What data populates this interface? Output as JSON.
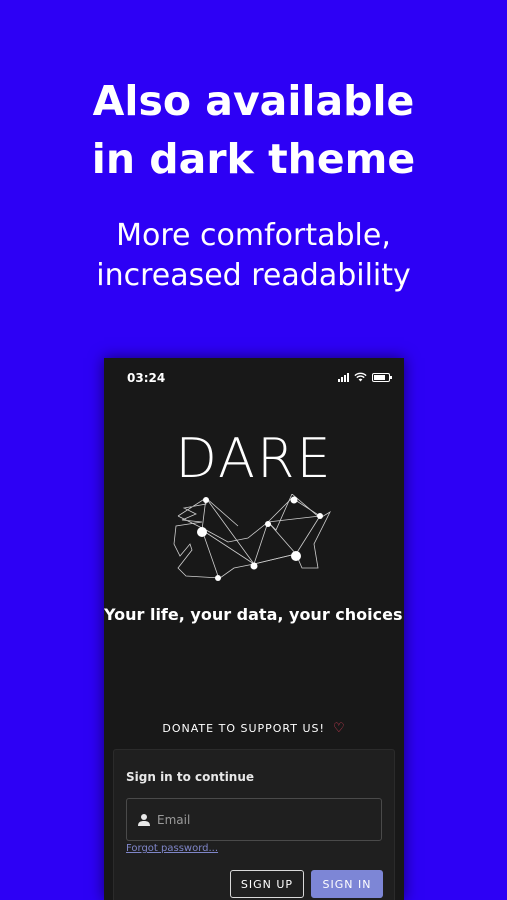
{
  "promo": {
    "headline_line1": "Also available",
    "headline_line2": "in dark theme",
    "subline_line1": "More comfortable,",
    "subline_line2": "increased readability"
  },
  "status_bar": {
    "time": "03:24",
    "icons": [
      "signal-icon",
      "wifi-icon",
      "battery-icon"
    ]
  },
  "app": {
    "logo_text": "DARE",
    "tagline": "Your life, your data, your choices.",
    "donate_label": "DONATE TO SUPPORT US!",
    "donate_icon": "heart-icon"
  },
  "signin": {
    "title": "Sign in to continue",
    "email_placeholder": "Email",
    "forgot_label": "Forgot password...",
    "signup_label": "SIGN UP",
    "signin_label": "SIGN IN"
  },
  "colors": {
    "background": "#2d00f5",
    "phone_bg": "#181818",
    "accent": "#7d86d6",
    "link": "#7f86c9",
    "heart": "#e0405a"
  }
}
